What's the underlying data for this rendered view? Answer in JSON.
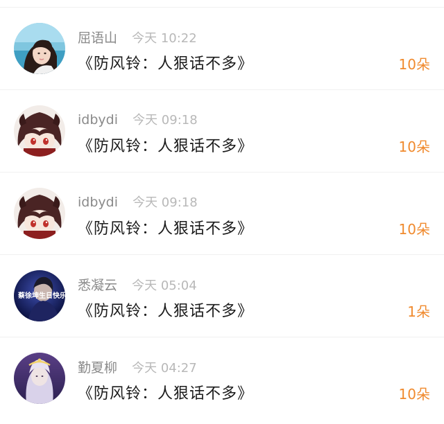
{
  "accent_color": "#f08a2e",
  "gift_list": [
    {
      "user": "屈语山",
      "time": "今天 10:22",
      "title": "《防风铃：人狠话不多》",
      "count": "10朵",
      "avatar": "avatar-beach-portrait"
    },
    {
      "user": "idbydi",
      "time": "今天 09:18",
      "title": "《防风铃：人狠话不多》",
      "count": "10朵",
      "avatar": "avatar-anime-chibi"
    },
    {
      "user": "idbydi",
      "time": "今天 09:18",
      "title": "《防风铃：人狠话不多》",
      "count": "10朵",
      "avatar": "avatar-anime-chibi"
    },
    {
      "user": "悉凝云",
      "time": "今天 05:04",
      "title": "《防风铃：人狠话不多》",
      "count": "1朵",
      "avatar": "avatar-birthday-poster",
      "avatar_text": "蔡徐坤生日快乐"
    },
    {
      "user": "勤夏柳",
      "time": "今天 04:27",
      "title": "《防风铃：人狠话不多》",
      "count": "10朵",
      "avatar": "avatar-purple-portrait"
    }
  ]
}
